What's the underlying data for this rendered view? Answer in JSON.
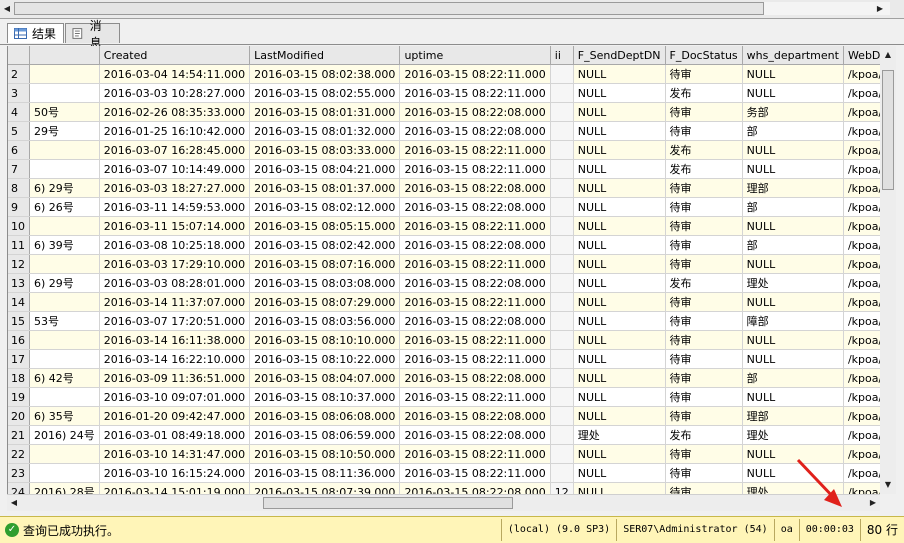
{
  "tabs": [
    {
      "label": "结果",
      "icon": "grid-results-icon",
      "active": true
    },
    {
      "label": "消息",
      "icon": "messages-icon",
      "active": false
    }
  ],
  "columns": [
    "",
    "",
    "Created",
    "LastModified",
    "uptime",
    "ii",
    "F_SendDeptDN",
    "F_DocStatus",
    "whs_department",
    "WebDbName"
  ],
  "rows": [
    [
      "2",
      "",
      "2016-03-04 14:54:11.000",
      "2016-03-15 08:02:38.000",
      "2016-03-15 08:22:11.000",
      "",
      "NULL",
      "待审",
      "NULL",
      "/kpoa/app/h"
    ],
    [
      "3",
      "",
      "2016-03-03 10:28:27.000",
      "2016-03-15 08:02:55.000",
      "2016-03-15 08:22:11.000",
      "",
      "NULL",
      "发布",
      "NULL",
      "/kpoa/app/h"
    ],
    [
      "4",
      "50号",
      "2016-02-26 08:35:33.000",
      "2016-03-15 08:01:31.000",
      "2016-03-15 08:22:08.000",
      "",
      "NULL",
      "待审",
      "务部",
      "/kpoa/app/h"
    ],
    [
      "5",
      "29号",
      "2016-01-25 16:10:42.000",
      "2016-03-15 08:01:32.000",
      "2016-03-15 08:22:08.000",
      "",
      "NULL",
      "待审",
      "部",
      "/kpoa/app/h"
    ],
    [
      "6",
      "",
      "2016-03-07 16:28:45.000",
      "2016-03-15 08:03:33.000",
      "2016-03-15 08:22:11.000",
      "",
      "NULL",
      "发布",
      "NULL",
      "/kpoa/app/h"
    ],
    [
      "7",
      "",
      "2016-03-07 10:14:49.000",
      "2016-03-15 08:04:21.000",
      "2016-03-15 08:22:11.000",
      "",
      "NULL",
      "发布",
      "NULL",
      "/kpoa/app/h"
    ],
    [
      "8",
      "6) 29号",
      "2016-03-03 18:27:27.000",
      "2016-03-15 08:01:37.000",
      "2016-03-15 08:22:08.000",
      "",
      "NULL",
      "待审",
      "理部",
      "/kpoa/app/h"
    ],
    [
      "9",
      "6) 26号",
      "2016-03-11 14:59:53.000",
      "2016-03-15 08:02:12.000",
      "2016-03-15 08:22:08.000",
      "",
      "NULL",
      "待审",
      "部",
      "/kpoa/app/h"
    ],
    [
      "10",
      "",
      "2016-03-11 15:07:14.000",
      "2016-03-15 08:05:15.000",
      "2016-03-15 08:22:11.000",
      "",
      "NULL",
      "待审",
      "NULL",
      "/kpoa/app/h"
    ],
    [
      "11",
      "6) 39号",
      "2016-03-08 10:25:18.000",
      "2016-03-15 08:02:42.000",
      "2016-03-15 08:22:08.000",
      "",
      "NULL",
      "待审",
      "部",
      "/kpoa/app/h"
    ],
    [
      "12",
      "",
      "2016-03-03 17:29:10.000",
      "2016-03-15 08:07:16.000",
      "2016-03-15 08:22:11.000",
      "",
      "NULL",
      "待审",
      "NULL",
      "/kpoa/app/h"
    ],
    [
      "13",
      "6) 29号",
      "2016-03-03 08:28:01.000",
      "2016-03-15 08:03:08.000",
      "2016-03-15 08:22:08.000",
      "",
      "NULL",
      "发布",
      "理处",
      "/kpoa/app/h"
    ],
    [
      "14",
      "",
      "2016-03-14 11:37:07.000",
      "2016-03-15 08:07:29.000",
      "2016-03-15 08:22:11.000",
      "",
      "NULL",
      "待审",
      "NULL",
      "/kpoa/app/h"
    ],
    [
      "15",
      "53号",
      "2016-03-07 17:20:51.000",
      "2016-03-15 08:03:56.000",
      "2016-03-15 08:22:08.000",
      "",
      "NULL",
      "待审",
      "障部",
      "/kpoa/app/h"
    ],
    [
      "16",
      "",
      "2016-03-14 16:11:38.000",
      "2016-03-15 08:10:10.000",
      "2016-03-15 08:22:11.000",
      "",
      "NULL",
      "待审",
      "NULL",
      "/kpoa/app/h"
    ],
    [
      "17",
      "",
      "2016-03-14 16:22:10.000",
      "2016-03-15 08:10:22.000",
      "2016-03-15 08:22:11.000",
      "",
      "NULL",
      "待审",
      "NULL",
      "/kpoa/app/h"
    ],
    [
      "18",
      "6) 42号",
      "2016-03-09 11:36:51.000",
      "2016-03-15 08:04:07.000",
      "2016-03-15 08:22:08.000",
      "",
      "NULL",
      "待审",
      "部",
      "/kpoa/app/h"
    ],
    [
      "19",
      "",
      "2016-03-10 09:07:01.000",
      "2016-03-15 08:10:37.000",
      "2016-03-15 08:22:11.000",
      "",
      "NULL",
      "待审",
      "NULL",
      "/kpoa/app/h"
    ],
    [
      "20",
      "6) 35号",
      "2016-01-20 09:42:47.000",
      "2016-03-15 08:06:08.000",
      "2016-03-15 08:22:08.000",
      "",
      "NULL",
      "待审",
      "理部",
      "/kpoa/app/h"
    ],
    [
      "21",
      "2016) 24号",
      "2016-03-01 08:49:18.000",
      "2016-03-15 08:06:59.000",
      "2016-03-15 08:22:08.000",
      "",
      "理处",
      "发布",
      "理处",
      "/kpoa/app/h"
    ],
    [
      "22",
      "",
      "2016-03-10 14:31:47.000",
      "2016-03-15 08:10:50.000",
      "2016-03-15 08:22:11.000",
      "",
      "NULL",
      "待审",
      "NULL",
      "/kpoa/app/h"
    ],
    [
      "23",
      "",
      "2016-03-10 16:15:24.000",
      "2016-03-15 08:11:36.000",
      "2016-03-15 08:22:11.000",
      "",
      "NULL",
      "待审",
      "NULL",
      "/kpoa/app/h"
    ],
    [
      "24",
      "2016) 28号",
      "2016-03-14 15:01:19.000",
      "2016-03-15 08:07:39.000",
      "2016-03-15 08:22:08.000",
      "12",
      "NULL",
      "待审",
      "理处",
      "/kpoa/app/h"
    ]
  ],
  "status": {
    "message": "查询已成功执行。",
    "server": "(local) (9.0 SP3)",
    "user": "SER07\\Administrator (54)",
    "db": "oa",
    "elapsed": "00:00:03",
    "rowcount": "80 行"
  },
  "colors": {
    "status_bg": "#fff5b8",
    "row_alt": "#fffde7",
    "annotation_arrow": "#e0211b"
  }
}
